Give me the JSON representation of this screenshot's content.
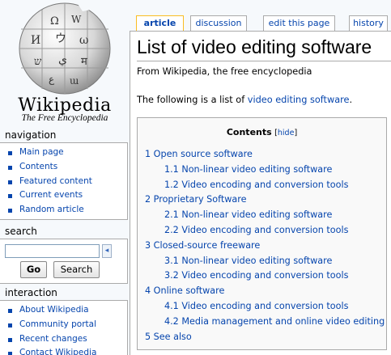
{
  "logo": {
    "wordmark": "Wikipedia",
    "tagline": "The Free Encyclopedia"
  },
  "tabs": [
    {
      "label": "article"
    },
    {
      "label": "discussion"
    },
    {
      "label": "edit this page"
    },
    {
      "label": "history"
    }
  ],
  "navigation": {
    "heading": "navigation",
    "items": [
      "Main page",
      "Contents",
      "Featured content",
      "Current events",
      "Random article"
    ]
  },
  "search": {
    "heading": "search",
    "query": "",
    "go_label": "Go",
    "search_label": "Search"
  },
  "interaction": {
    "heading": "interaction",
    "items": [
      "About Wikipedia",
      "Community portal",
      "Recent changes",
      "Contact Wikipedia"
    ]
  },
  "page": {
    "title": "List of video editing software",
    "site_sub": "From Wikipedia, the free encyclopedia",
    "intro_prefix": "The following is a list of ",
    "intro_link": "video editing software",
    "intro_suffix": "."
  },
  "toc": {
    "heading": "Contents",
    "bracket_open": "[",
    "hide_label": "hide",
    "bracket_close": "]",
    "items": [
      {
        "label": "1 Open source software",
        "level": 1
      },
      {
        "label": "1.1 Non-linear video editing software",
        "level": 2
      },
      {
        "label": "1.2 Video encoding and conversion tools",
        "level": 2
      },
      {
        "label": "2 Proprietary Software",
        "level": 1
      },
      {
        "label": "2.1 Non-linear video editing software",
        "level": 2
      },
      {
        "label": "2.2 Video encoding and conversion tools",
        "level": 2
      },
      {
        "label": "3 Closed-source freeware",
        "level": 1
      },
      {
        "label": "3.1 Non-linear video editing software",
        "level": 2
      },
      {
        "label": "3.2 Video encoding and conversion tools",
        "level": 2
      },
      {
        "label": "4 Online software",
        "level": 1
      },
      {
        "label": "4.1 Video encoding and conversion tools",
        "level": 2
      },
      {
        "label": "4.2 Media management and online video editing",
        "level": 2
      },
      {
        "label": "5 See also",
        "level": 1
      }
    ]
  },
  "colors": {
    "link": "#0645ad",
    "active_tab_border": "#fabd23",
    "background": "#f6f9fc"
  }
}
